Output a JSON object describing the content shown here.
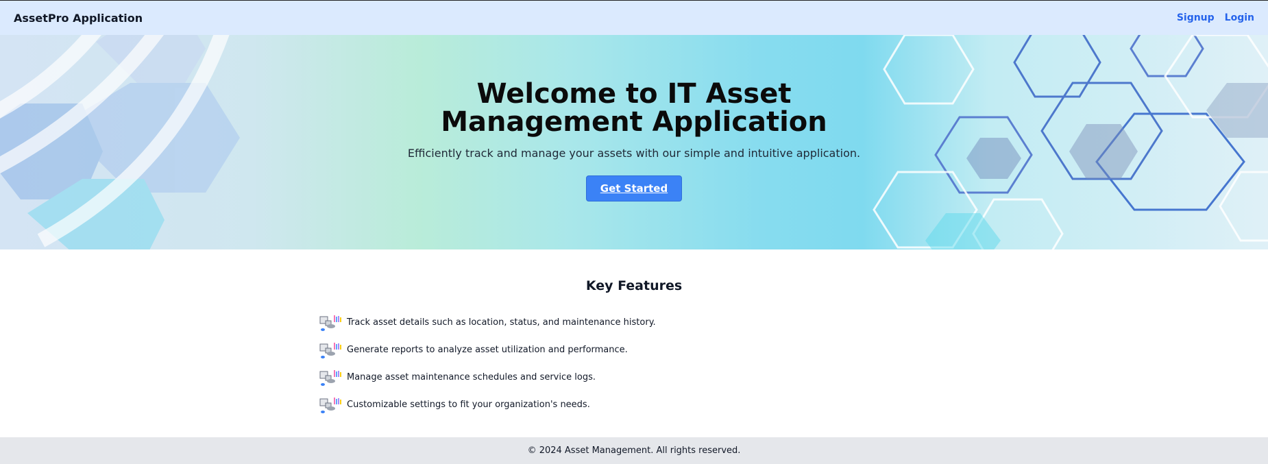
{
  "header": {
    "brand": "AssetPro Application",
    "nav": {
      "signup": "Signup",
      "login": "Login"
    }
  },
  "hero": {
    "title": "Welcome to IT Asset Management Application",
    "subtitle": "Efficiently track and manage your assets with our simple and intuitive application.",
    "cta_label": "Get Started",
    "background_icon": "hexagon-pattern"
  },
  "features": {
    "title": "Key Features",
    "item_icon": "asset-devices-icon",
    "items": [
      "Track asset details such as location, status, and maintenance history.",
      "Generate reports to analyze asset utilization and performance.",
      "Manage asset maintenance schedules and service logs.",
      "Customizable settings to fit your organization's needs."
    ]
  },
  "footer": {
    "copyright": "© 2024 Asset Management. All rights reserved."
  },
  "colors": {
    "header_bg": "#dbeafe",
    "link": "#2563eb",
    "cta": "#3b82f6",
    "footer_bg": "#e5e7eb"
  }
}
